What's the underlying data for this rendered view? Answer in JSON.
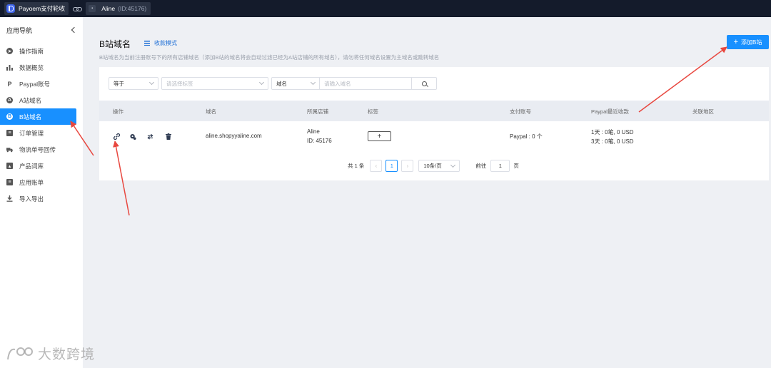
{
  "topbar": {
    "app_name": "Payoem支付轮收",
    "store_name": "Aline",
    "store_id": "(ID:45176)"
  },
  "sidebar": {
    "title": "应用导航",
    "items": [
      {
        "label": "操作指南",
        "icon": "compass-icon"
      },
      {
        "label": "数据概览",
        "icon": "bar-chart-icon"
      },
      {
        "label": "Paypal账号",
        "icon": "paypal-icon"
      },
      {
        "label": "A站域名",
        "icon": "letter-a-icon"
      },
      {
        "label": "B站域名",
        "icon": "letter-b-icon",
        "active": true
      },
      {
        "label": "订单管理",
        "icon": "clipboard-icon"
      },
      {
        "label": "物流单号回传",
        "icon": "truck-icon"
      },
      {
        "label": "产品词库",
        "icon": "id-card-icon"
      },
      {
        "label": "应用账单",
        "icon": "document-icon"
      },
      {
        "label": "导入导出",
        "icon": "download-icon"
      }
    ]
  },
  "header": {
    "title": "B站域名",
    "mode_link": "收款模式",
    "description": "B站域名为当前注册账号下的所有店铺域名（添加B站的域名将会自动过滤已经为A站店铺的所有域名），请勿将任何域名设置为主域名或跳转域名",
    "add_button": "添加B站"
  },
  "filters": {
    "operator": "等于",
    "tag_placeholder": "请选择标签",
    "field": "域名",
    "input_placeholder": "请输入域名"
  },
  "table": {
    "columns": [
      "操作",
      "域名",
      "所属店铺",
      "标签",
      "支付账号",
      "Paypal最近收款",
      "关联地区"
    ],
    "rows": [
      {
        "domain": "aline.shopyyaline.com",
        "store_name": "Aline",
        "store_id": "ID: 45176",
        "tag_add": "+",
        "payment": "Paypal : 0 个",
        "recent_1": "1天 : 0笔,   0 USD",
        "recent_3": "3天 : 0笔,   0 USD",
        "region": ""
      }
    ]
  },
  "pagination": {
    "total": "共 1 条",
    "current": "1",
    "page_size": "10条/页",
    "goto_label": "前往",
    "goto_value": "1",
    "page_suffix": "页"
  },
  "watermark": "大数跨境",
  "colors": {
    "accent": "#1890ff",
    "topbar": "#141b2b",
    "arrow": "#e8473f"
  }
}
